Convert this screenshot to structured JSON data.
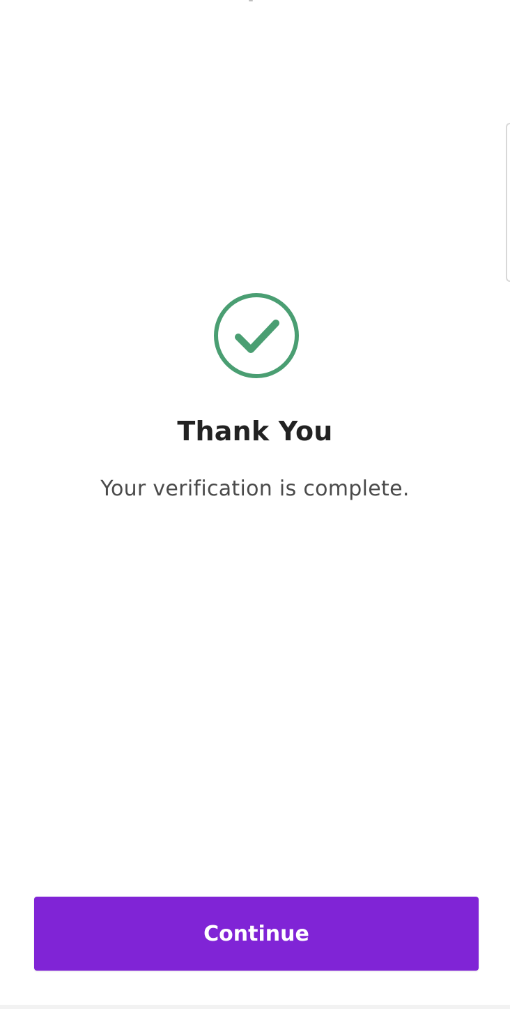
{
  "confirmation": {
    "icon": "check-circle-icon",
    "icon_color": "#4a9e72",
    "title": "Thank You",
    "message": "Your verification is complete."
  },
  "actions": {
    "continue_label": "Continue",
    "continue_color": "#8024d6"
  }
}
